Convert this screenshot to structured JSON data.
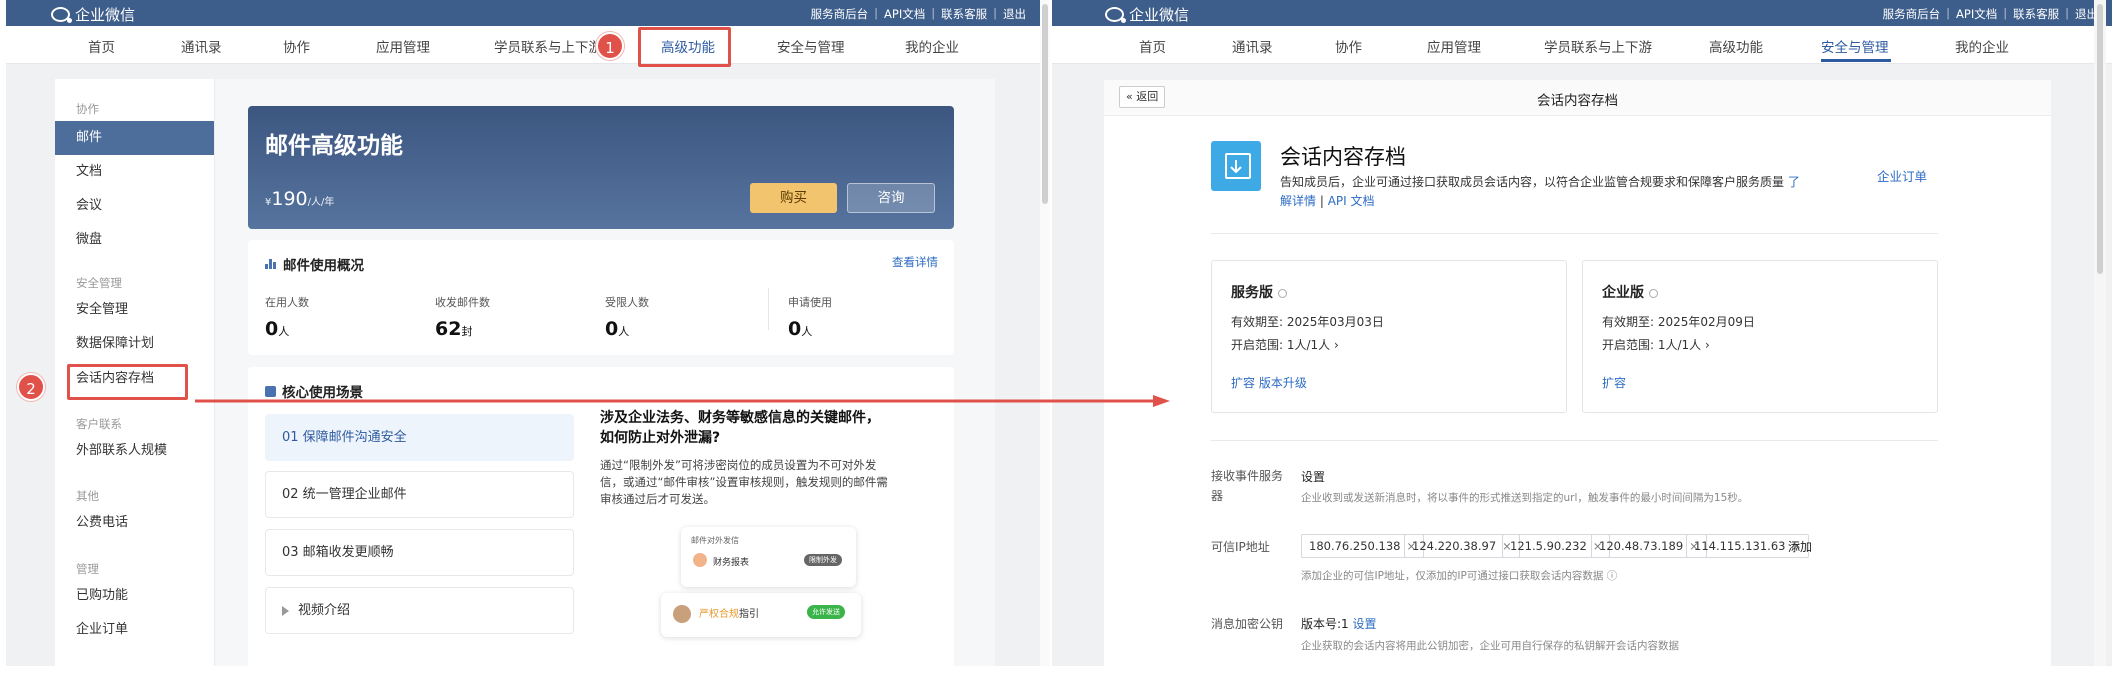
{
  "brand": "企业微信",
  "top_links": [
    "服务商后台",
    "API文档",
    "联系客服",
    "退出"
  ],
  "nav": [
    "首页",
    "通讯录",
    "协作",
    "应用管理",
    "学员联系与上下游",
    "高级功能",
    "安全与管理",
    "我的企业"
  ],
  "left": {
    "sidebar": {
      "groups": [
        {
          "label": "协作",
          "items": [
            "邮件",
            "文档",
            "会议",
            "微盘"
          ]
        },
        {
          "label": "安全管理",
          "items": [
            "安全管理",
            "数据保障计划",
            "会话内容存档"
          ]
        },
        {
          "label": "客户联系",
          "items": [
            "外部联系人规模"
          ]
        },
        {
          "label": "其他",
          "items": [
            "公费电话"
          ]
        },
        {
          "label": "管理",
          "items": [
            "已购功能",
            "企业订单"
          ]
        }
      ]
    },
    "banner": {
      "title": "邮件高级功能",
      "price_symbol": "¥",
      "price": "190",
      "price_unit": "/人/年",
      "buy": "购买",
      "consult": "咨询"
    },
    "overview": {
      "title": "邮件使用概况",
      "link": "查看详情",
      "stats": [
        {
          "label": "在用人数",
          "value": "0",
          "unit": "人"
        },
        {
          "label": "收发邮件数",
          "value": "62",
          "unit": "封"
        },
        {
          "label": "受限人数",
          "value": "0",
          "unit": "人"
        },
        {
          "label": "申请使用",
          "value": "0",
          "unit": "人"
        }
      ]
    },
    "scenes": {
      "title": "核心使用场景",
      "items": [
        "01 保障邮件沟通安全",
        "02 统一管理企业邮件",
        "03 邮箱收发更顺畅",
        "视频介绍"
      ],
      "article_title": "涉及企业法务、财务等敏感信息的关键邮件，如何防止对外泄漏?",
      "article_desc": "通过“限制外发”可将涉密岗位的成员设置为不可对外发信，或通过“邮件审核”设置审核规则，触发规则的邮件需审核通过后才可发送。",
      "mock_title": "邮件对外发信",
      "mock_row": "财务报表",
      "mock_tag": "限制外发",
      "mock_row2a": "严权合规",
      "mock_row2b": "指引",
      "mock_tag2": "允许发送"
    }
  },
  "annotations": [
    "1",
    "2"
  ],
  "right": {
    "back": "« 返回",
    "title": "会话内容存档",
    "heading": "会话内容存档",
    "desc": "告知成员后，企业可通过接口获取成员会话内容，以符合企业监管合规要求和保障客户服务质量",
    "desc_link1": "了解详情",
    "desc_sep": "|",
    "desc_link2": "API 文档",
    "order_link": "企业订单",
    "plans": [
      {
        "name": "服务版",
        "expiry": "有效期至: 2025年03月03日",
        "scope": "开启范围: 1人/1人 ›",
        "actions": "扩容   版本升级"
      },
      {
        "name": "企业版",
        "expiry": "有效期至: 2025年02月09日",
        "scope": "开启范围: 1人/1人 ›",
        "actions": "扩容"
      }
    ],
    "event_label": "接收事件服务器",
    "event_value": "设置",
    "event_hint": "企业收到或发送新消息时，将以事件的形式推送到指定的url，触发事件的最小时间间隔为15秒。",
    "ip_label": "可信IP地址",
    "ips": [
      "180.76.250.138",
      "124.220.38.97",
      "121.5.90.232",
      "120.48.73.189",
      "114.115.131.63"
    ],
    "ip_add": "添加",
    "ip_hint": "添加企业的可信IP地址，仅添加的IP可通过接口获取会话内容数据 ⓘ",
    "key_label": "消息加密公钥",
    "key_value": "版本号:1",
    "key_link": "设置",
    "key_hint": "企业获取的会话内容将用此公钥加密，企业可用自行保存的私钥解开会话内容数据"
  }
}
